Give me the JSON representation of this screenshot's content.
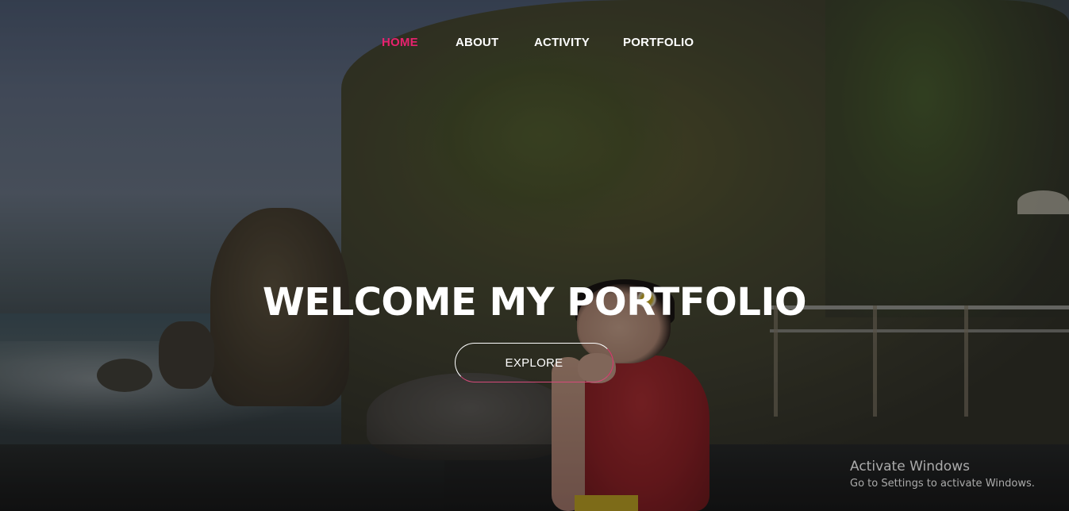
{
  "nav": {
    "items": [
      {
        "label": "HOME",
        "active": true
      },
      {
        "label": "ABOUT",
        "active": false
      },
      {
        "label": "ACTIVITY",
        "active": false
      },
      {
        "label": "PORTFOLIO",
        "active": false
      }
    ],
    "active_color": "#e8226e"
  },
  "hero": {
    "headline": "WELCOME MY PORTFOLIO",
    "cta_label": "EXPLORE",
    "accent_color": "#e0336e"
  },
  "watermark": {
    "title": "Activate Windows",
    "subtitle": "Go to Settings to activate Windows."
  }
}
